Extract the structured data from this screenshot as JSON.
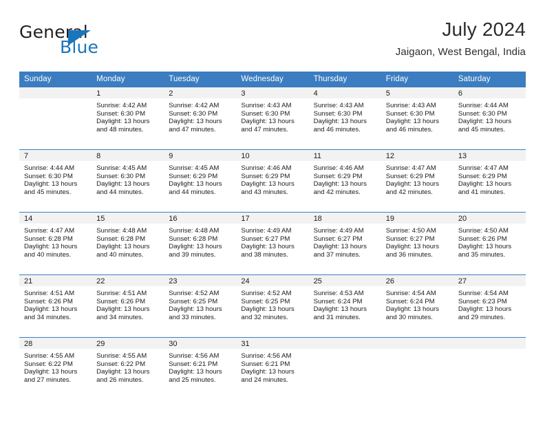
{
  "brand": {
    "word_one": "General",
    "word_two": "Blue",
    "triangle_icon": "triangle-icon"
  },
  "header": {
    "title": "July 2024",
    "subtitle": "Jaigaon, West Bengal, India"
  },
  "colors": {
    "header_blue": "#3b7dc0",
    "brand_blue": "#1b75bb",
    "daynum_band": "#f2f2f2",
    "text": "#1a1a1a"
  },
  "weekdays": [
    "Sunday",
    "Monday",
    "Tuesday",
    "Wednesday",
    "Thursday",
    "Friday",
    "Saturday"
  ],
  "labels": {
    "sunrise": "Sunrise:",
    "sunset": "Sunset:",
    "daylight": "Daylight:"
  },
  "weeks": [
    [
      {
        "day": "",
        "sunrise": "",
        "sunset": "",
        "daylight_line1": "",
        "daylight_line2": ""
      },
      {
        "day": "1",
        "sunrise": "Sunrise: 4:42 AM",
        "sunset": "Sunset: 6:30 PM",
        "daylight_line1": "Daylight: 13 hours",
        "daylight_line2": "and 48 minutes."
      },
      {
        "day": "2",
        "sunrise": "Sunrise: 4:42 AM",
        "sunset": "Sunset: 6:30 PM",
        "daylight_line1": "Daylight: 13 hours",
        "daylight_line2": "and 47 minutes."
      },
      {
        "day": "3",
        "sunrise": "Sunrise: 4:43 AM",
        "sunset": "Sunset: 6:30 PM",
        "daylight_line1": "Daylight: 13 hours",
        "daylight_line2": "and 47 minutes."
      },
      {
        "day": "4",
        "sunrise": "Sunrise: 4:43 AM",
        "sunset": "Sunset: 6:30 PM",
        "daylight_line1": "Daylight: 13 hours",
        "daylight_line2": "and 46 minutes."
      },
      {
        "day": "5",
        "sunrise": "Sunrise: 4:43 AM",
        "sunset": "Sunset: 6:30 PM",
        "daylight_line1": "Daylight: 13 hours",
        "daylight_line2": "and 46 minutes."
      },
      {
        "day": "6",
        "sunrise": "Sunrise: 4:44 AM",
        "sunset": "Sunset: 6:30 PM",
        "daylight_line1": "Daylight: 13 hours",
        "daylight_line2": "and 45 minutes."
      }
    ],
    [
      {
        "day": "7",
        "sunrise": "Sunrise: 4:44 AM",
        "sunset": "Sunset: 6:30 PM",
        "daylight_line1": "Daylight: 13 hours",
        "daylight_line2": "and 45 minutes."
      },
      {
        "day": "8",
        "sunrise": "Sunrise: 4:45 AM",
        "sunset": "Sunset: 6:30 PM",
        "daylight_line1": "Daylight: 13 hours",
        "daylight_line2": "and 44 minutes."
      },
      {
        "day": "9",
        "sunrise": "Sunrise: 4:45 AM",
        "sunset": "Sunset: 6:29 PM",
        "daylight_line1": "Daylight: 13 hours",
        "daylight_line2": "and 44 minutes."
      },
      {
        "day": "10",
        "sunrise": "Sunrise: 4:46 AM",
        "sunset": "Sunset: 6:29 PM",
        "daylight_line1": "Daylight: 13 hours",
        "daylight_line2": "and 43 minutes."
      },
      {
        "day": "11",
        "sunrise": "Sunrise: 4:46 AM",
        "sunset": "Sunset: 6:29 PM",
        "daylight_line1": "Daylight: 13 hours",
        "daylight_line2": "and 42 minutes."
      },
      {
        "day": "12",
        "sunrise": "Sunrise: 4:47 AM",
        "sunset": "Sunset: 6:29 PM",
        "daylight_line1": "Daylight: 13 hours",
        "daylight_line2": "and 42 minutes."
      },
      {
        "day": "13",
        "sunrise": "Sunrise: 4:47 AM",
        "sunset": "Sunset: 6:29 PM",
        "daylight_line1": "Daylight: 13 hours",
        "daylight_line2": "and 41 minutes."
      }
    ],
    [
      {
        "day": "14",
        "sunrise": "Sunrise: 4:47 AM",
        "sunset": "Sunset: 6:28 PM",
        "daylight_line1": "Daylight: 13 hours",
        "daylight_line2": "and 40 minutes."
      },
      {
        "day": "15",
        "sunrise": "Sunrise: 4:48 AM",
        "sunset": "Sunset: 6:28 PM",
        "daylight_line1": "Daylight: 13 hours",
        "daylight_line2": "and 40 minutes."
      },
      {
        "day": "16",
        "sunrise": "Sunrise: 4:48 AM",
        "sunset": "Sunset: 6:28 PM",
        "daylight_line1": "Daylight: 13 hours",
        "daylight_line2": "and 39 minutes."
      },
      {
        "day": "17",
        "sunrise": "Sunrise: 4:49 AM",
        "sunset": "Sunset: 6:27 PM",
        "daylight_line1": "Daylight: 13 hours",
        "daylight_line2": "and 38 minutes."
      },
      {
        "day": "18",
        "sunrise": "Sunrise: 4:49 AM",
        "sunset": "Sunset: 6:27 PM",
        "daylight_line1": "Daylight: 13 hours",
        "daylight_line2": "and 37 minutes."
      },
      {
        "day": "19",
        "sunrise": "Sunrise: 4:50 AM",
        "sunset": "Sunset: 6:27 PM",
        "daylight_line1": "Daylight: 13 hours",
        "daylight_line2": "and 36 minutes."
      },
      {
        "day": "20",
        "sunrise": "Sunrise: 4:50 AM",
        "sunset": "Sunset: 6:26 PM",
        "daylight_line1": "Daylight: 13 hours",
        "daylight_line2": "and 35 minutes."
      }
    ],
    [
      {
        "day": "21",
        "sunrise": "Sunrise: 4:51 AM",
        "sunset": "Sunset: 6:26 PM",
        "daylight_line1": "Daylight: 13 hours",
        "daylight_line2": "and 34 minutes."
      },
      {
        "day": "22",
        "sunrise": "Sunrise: 4:51 AM",
        "sunset": "Sunset: 6:26 PM",
        "daylight_line1": "Daylight: 13 hours",
        "daylight_line2": "and 34 minutes."
      },
      {
        "day": "23",
        "sunrise": "Sunrise: 4:52 AM",
        "sunset": "Sunset: 6:25 PM",
        "daylight_line1": "Daylight: 13 hours",
        "daylight_line2": "and 33 minutes."
      },
      {
        "day": "24",
        "sunrise": "Sunrise: 4:52 AM",
        "sunset": "Sunset: 6:25 PM",
        "daylight_line1": "Daylight: 13 hours",
        "daylight_line2": "and 32 minutes."
      },
      {
        "day": "25",
        "sunrise": "Sunrise: 4:53 AM",
        "sunset": "Sunset: 6:24 PM",
        "daylight_line1": "Daylight: 13 hours",
        "daylight_line2": "and 31 minutes."
      },
      {
        "day": "26",
        "sunrise": "Sunrise: 4:54 AM",
        "sunset": "Sunset: 6:24 PM",
        "daylight_line1": "Daylight: 13 hours",
        "daylight_line2": "and 30 minutes."
      },
      {
        "day": "27",
        "sunrise": "Sunrise: 4:54 AM",
        "sunset": "Sunset: 6:23 PM",
        "daylight_line1": "Daylight: 13 hours",
        "daylight_line2": "and 29 minutes."
      }
    ],
    [
      {
        "day": "28",
        "sunrise": "Sunrise: 4:55 AM",
        "sunset": "Sunset: 6:22 PM",
        "daylight_line1": "Daylight: 13 hours",
        "daylight_line2": "and 27 minutes."
      },
      {
        "day": "29",
        "sunrise": "Sunrise: 4:55 AM",
        "sunset": "Sunset: 6:22 PM",
        "daylight_line1": "Daylight: 13 hours",
        "daylight_line2": "and 26 minutes."
      },
      {
        "day": "30",
        "sunrise": "Sunrise: 4:56 AM",
        "sunset": "Sunset: 6:21 PM",
        "daylight_line1": "Daylight: 13 hours",
        "daylight_line2": "and 25 minutes."
      },
      {
        "day": "31",
        "sunrise": "Sunrise: 4:56 AM",
        "sunset": "Sunset: 6:21 PM",
        "daylight_line1": "Daylight: 13 hours",
        "daylight_line2": "and 24 minutes."
      },
      {
        "day": "",
        "sunrise": "",
        "sunset": "",
        "daylight_line1": "",
        "daylight_line2": ""
      },
      {
        "day": "",
        "sunrise": "",
        "sunset": "",
        "daylight_line1": "",
        "daylight_line2": ""
      },
      {
        "day": "",
        "sunrise": "",
        "sunset": "",
        "daylight_line1": "",
        "daylight_line2": ""
      }
    ]
  ]
}
